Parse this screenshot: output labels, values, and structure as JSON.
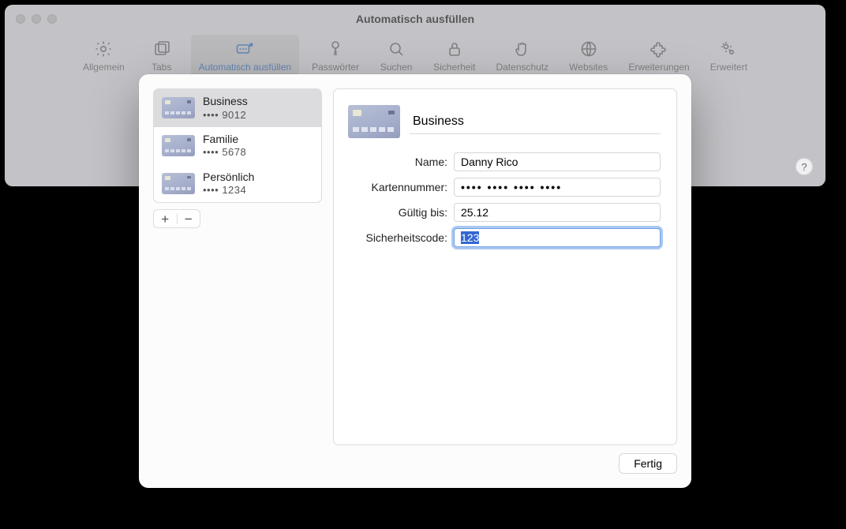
{
  "window_title": "Automatisch ausfüllen",
  "toolbar": [
    {
      "id": "allgemein",
      "label": "Allgemein",
      "icon": "gear"
    },
    {
      "id": "tabs",
      "label": "Tabs",
      "icon": "tabs"
    },
    {
      "id": "autofill",
      "label": "Automatisch ausfüllen",
      "icon": "autofill",
      "selected": true
    },
    {
      "id": "passwoerter",
      "label": "Passwörter",
      "icon": "key"
    },
    {
      "id": "suchen",
      "label": "Suchen",
      "icon": "search"
    },
    {
      "id": "sicherheit",
      "label": "Sicherheit",
      "icon": "lock"
    },
    {
      "id": "datenschutz",
      "label": "Datenschutz",
      "icon": "hand"
    },
    {
      "id": "websites",
      "label": "Websites",
      "icon": "globe"
    },
    {
      "id": "erweiterungen",
      "label": "Erweiterungen",
      "icon": "puzzle"
    },
    {
      "id": "erweitert",
      "label": "Erweitert",
      "icon": "gears"
    }
  ],
  "help_label": "?",
  "cards": [
    {
      "name": "Business",
      "masked": "•••• 9012",
      "selected": true
    },
    {
      "name": "Familie",
      "masked": "•••• 5678"
    },
    {
      "name": "Persönlich",
      "masked": "•••• 1234"
    }
  ],
  "add_label": "+",
  "remove_label": "−",
  "detail": {
    "title_value": "Business",
    "rows": {
      "name_label": "Name:",
      "name_value": "Danny Rico",
      "number_label": "Kartennummer:",
      "number_value": "•••• •••• •••• ••••",
      "expiry_label": "Gültig bis:",
      "expiry_value": "25.12",
      "cvc_label": "Sicherheitscode:",
      "cvc_value": "123"
    }
  },
  "done_label": "Fertig"
}
